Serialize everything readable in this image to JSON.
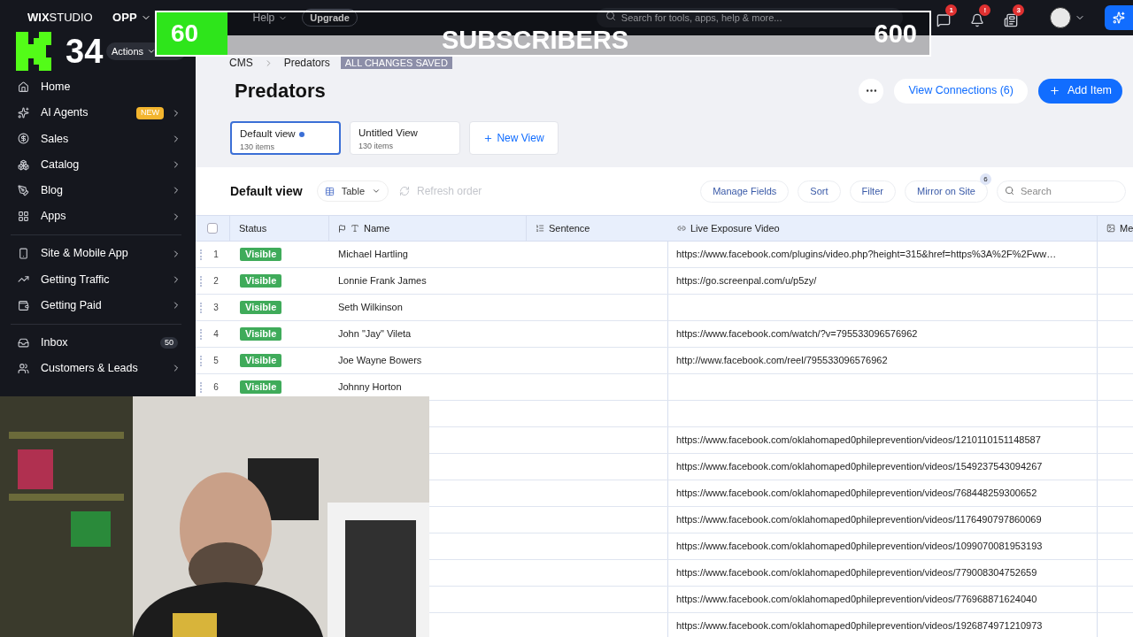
{
  "overlay": {
    "current": "60",
    "counter_label": "SUBSCRIBERS",
    "goal": "600",
    "kick_count": "34"
  },
  "topbar": {
    "logo_bold": "WIX",
    "logo_rest": "STUDIO",
    "site": "OPP",
    "menu": [
      "Help"
    ],
    "upgrade": "Upgrade",
    "search_placeholder": "Search for tools, apps, help & more...",
    "notifications": [
      {
        "badge": "1"
      },
      {
        "badge": "!"
      },
      {
        "badge": "3"
      }
    ]
  },
  "sidebar": {
    "actions": "Actions",
    "groups": [
      [
        {
          "label": "Home",
          "submenu": false
        },
        {
          "label": "AI Agents",
          "badge": "NEW",
          "submenu": true
        },
        {
          "label": "Sales",
          "submenu": true
        },
        {
          "label": "Catalog",
          "submenu": true
        },
        {
          "label": "Blog",
          "submenu": true
        },
        {
          "label": "Apps",
          "submenu": true
        }
      ],
      [
        {
          "label": "Site & Mobile App",
          "submenu": true
        },
        {
          "label": "Getting Traffic",
          "submenu": true
        },
        {
          "label": "Getting Paid",
          "submenu": true
        }
      ],
      [
        {
          "label": "Inbox",
          "count": "50",
          "submenu": false
        },
        {
          "label": "Customers & Leads",
          "submenu": true
        }
      ]
    ]
  },
  "breadcrumb": [
    "CMS",
    "Predators"
  ],
  "save_status": "ALL CHANGES SAVED",
  "title": "Predators",
  "view_connections": "View Connections (6)",
  "add_item": "Add Item",
  "views": [
    {
      "name": "Default view",
      "count": "130 items",
      "selected": true,
      "modified": true
    },
    {
      "name": "Untitled View",
      "count": "130 items",
      "selected": false,
      "modified": false
    }
  ],
  "new_view": "New View",
  "toolbar": {
    "title": "Default view",
    "layout": "Table",
    "refresh": "Refresh order",
    "refresh_disabled": true,
    "buttons": [
      {
        "label": "Manage Fields"
      },
      {
        "label": "Sort"
      },
      {
        "label": "Filter"
      },
      {
        "label": "Mirror on Site",
        "badge": "6"
      }
    ],
    "search_placeholder": "Search"
  },
  "table": {
    "select_all": {
      "checked": false
    },
    "columns": [
      "Status",
      "Name",
      "Sentence",
      "Live Exposure Video",
      "Me"
    ],
    "rows": [
      {
        "number": "1",
        "status": "Visible",
        "name": "Michael Hartling",
        "video": "https://www.facebook.com/plugins/video.php?height=315&href=https%3A%2F%2Fww…"
      },
      {
        "number": "2",
        "status": "Visible",
        "name": "Lonnie Frank James",
        "video": "https://go.screenpal.com/u/p5zy/"
      },
      {
        "number": "3",
        "status": "Visible",
        "name": "Seth Wilkinson"
      },
      {
        "number": "4",
        "status": "Visible",
        "name": "John \"Jay\" Vileta",
        "video": "https://www.facebook.com/watch/?v=795533096576962"
      },
      {
        "number": "5",
        "status": "Visible",
        "name": "Joe Wayne Bowers",
        "video": "http://www.facebook.com/reel/795533096576962"
      },
      {
        "number": "6",
        "status": "Visible",
        "name": "Johnny Horton"
      },
      {},
      {
        "video": "https://www.facebook.com/oklahomaped0phileprevention/videos/1210110151148587"
      },
      {
        "video": "https://www.facebook.com/oklahomaped0phileprevention/videos/1549237543094267"
      },
      {
        "video": "https://www.facebook.com/oklahomaped0phileprevention/videos/768448259300652"
      },
      {
        "video": "https://www.facebook.com/oklahomaped0phileprevention/videos/1176490797860069"
      },
      {
        "video": "https://www.facebook.com/oklahomaped0phileprevention/videos/1099070081953193"
      },
      {
        "video": "https://www.facebook.com/oklahomaped0phileprevention/videos/779008304752659"
      },
      {
        "video": "https://www.facebook.com/oklahomaped0phileprevention/videos/776968871624040"
      },
      {
        "video": "https://www.facebook.com/oklahomaped0phileprevention/videos/1926874971210973"
      }
    ]
  }
}
